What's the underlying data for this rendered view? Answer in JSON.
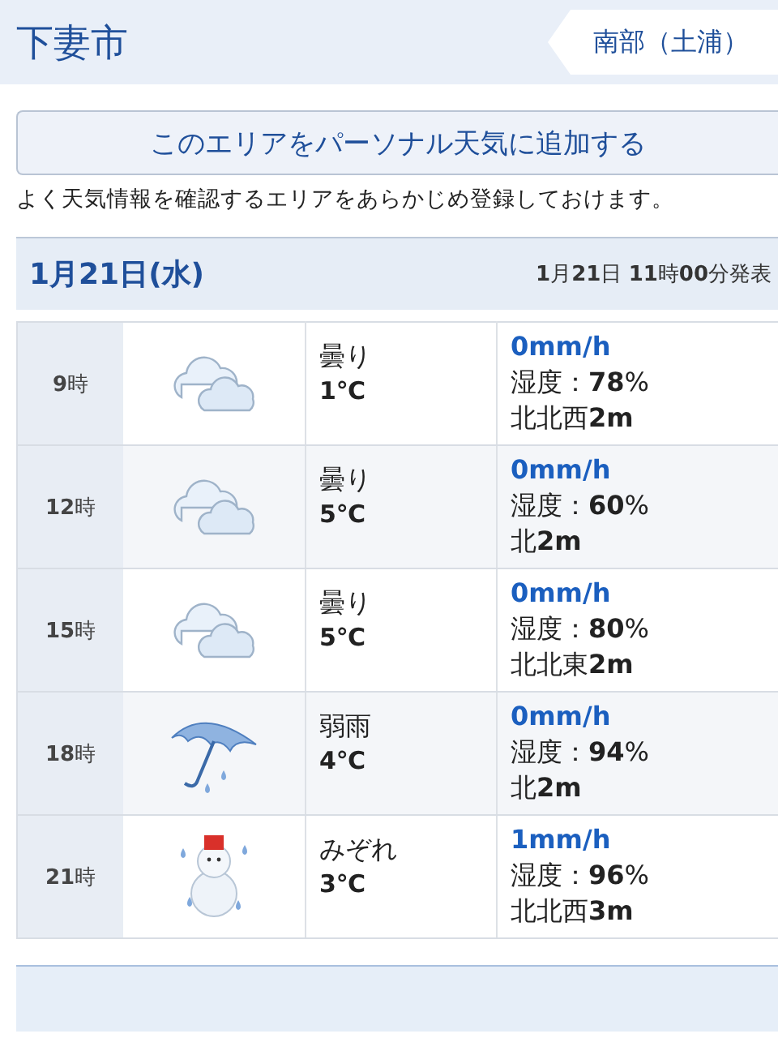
{
  "header": {
    "title": "下妻市",
    "region_button": "南部（土浦）"
  },
  "add_button": "このエリアをパーソナル天気に追加する",
  "description": "よく天気情報を確認するエリアをあらかじめ登録しておけます。",
  "date_bar": {
    "date": "1月21日(水)",
    "issued": "**1**月**21**日 **11**時**00**分発表"
  },
  "forecast": [
    {
      "time": "**9**時",
      "kind": "cloudy",
      "weather": "曇り",
      "temp": "1℃",
      "rain": "0mm/h",
      "humidity": "湿度：**78**%",
      "wind": "北北西**2m**"
    },
    {
      "time": "**12**時",
      "kind": "cloudy",
      "weather": "曇り",
      "temp": "5℃",
      "rain": "0mm/h",
      "humidity": "湿度：**60**%",
      "wind": "北**2m**"
    },
    {
      "time": "**15**時",
      "kind": "cloudy",
      "weather": "曇り",
      "temp": "5℃",
      "rain": "0mm/h",
      "humidity": "湿度：**80**%",
      "wind": "北北東**2m**"
    },
    {
      "time": "**18**時",
      "kind": "rain",
      "weather": "弱雨",
      "temp": "4℃",
      "rain": "0mm/h",
      "humidity": "湿度：**94**%",
      "wind": "北**2m**"
    },
    {
      "time": "**21**時",
      "kind": "sleet",
      "weather": "みぞれ",
      "temp": "3℃",
      "rain": "1mm/h",
      "humidity": "湿度：**96**%",
      "wind": "北北西**3m**"
    }
  ]
}
